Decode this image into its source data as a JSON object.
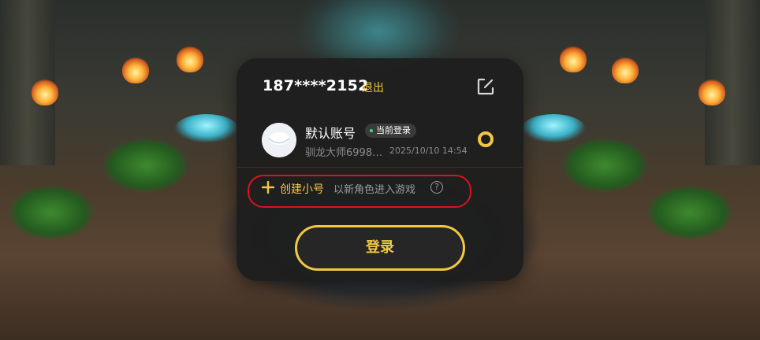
{
  "account_header": {
    "phone": "187****2152",
    "logout_label": "退出",
    "edit_icon": "edit-square-icon"
  },
  "account": {
    "name": "默认账号",
    "status_badge": "当前登录",
    "character": "驯龙大师6998…",
    "last_login": "2025/10/10 14:54",
    "selected": true
  },
  "create_sub_account": {
    "label": "创建小号",
    "description": "以新角色进入游戏",
    "help_icon": "?"
  },
  "login_button": {
    "label": "登录"
  },
  "colors": {
    "accent": "#f2c744",
    "dialog_bg": "#1e1e1e",
    "online_dot": "#3ddc84",
    "highlight_box": "#e0101e"
  }
}
